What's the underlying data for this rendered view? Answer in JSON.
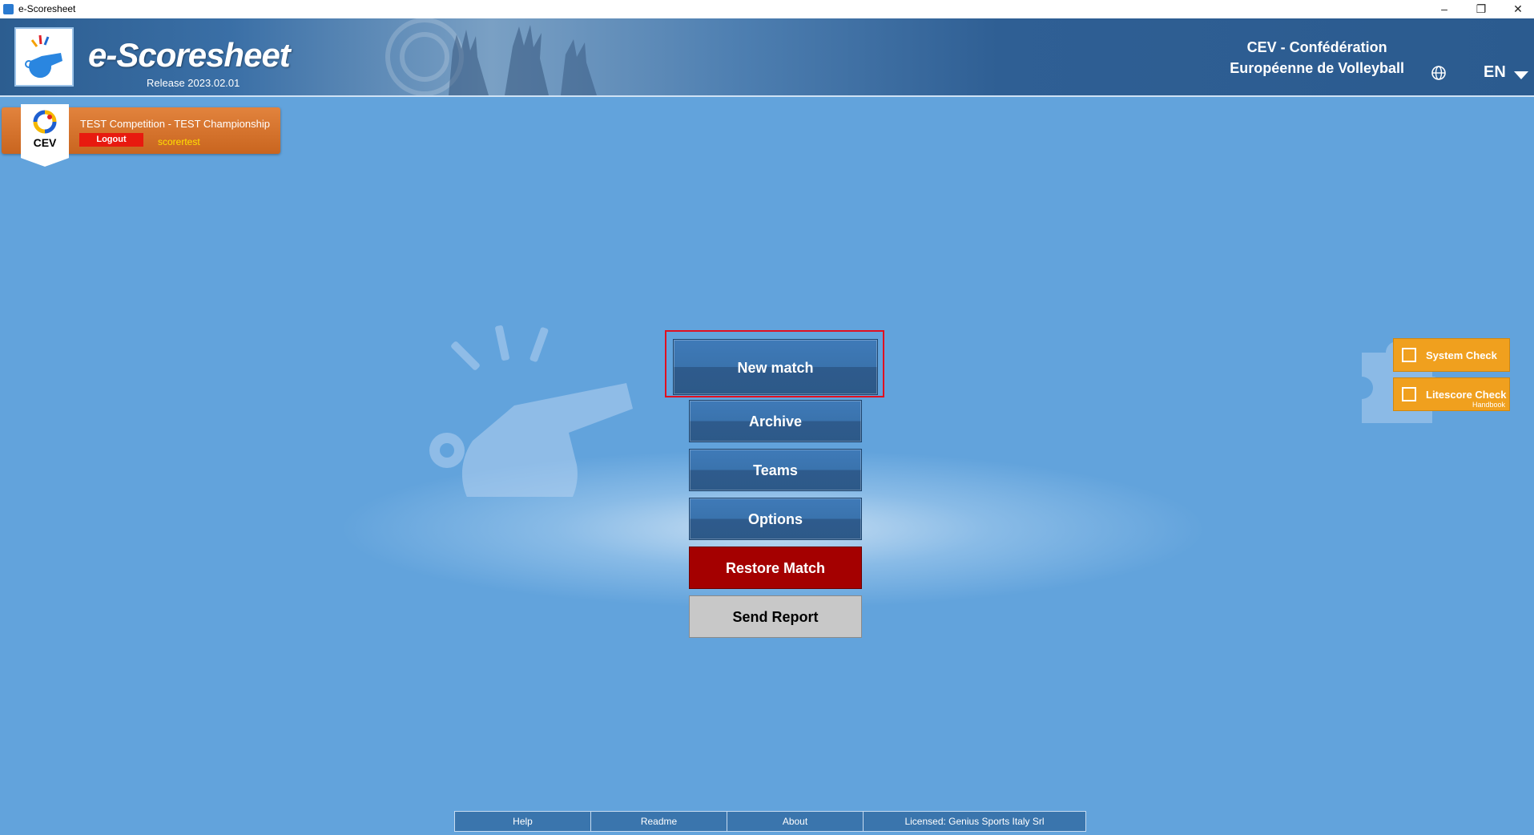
{
  "window": {
    "title": "e-Scoresheet",
    "minimize": "–",
    "restore": "❐",
    "close": "✕"
  },
  "header": {
    "app_name": "e-Scoresheet",
    "release": "Release 2023.02.01",
    "org_line1": "CEV - Confédération",
    "org_line2": "Européenne de Volleyball",
    "language": "EN",
    "globe_icon": "globe-icon",
    "logo_icon": "whistle-logo-icon"
  },
  "competition": {
    "badge_label": "CEV",
    "name": "TEST Competition - TEST Championship",
    "logout_label": "Logout",
    "username": "scorertest"
  },
  "menu": {
    "new_match": "New match",
    "archive": "Archive",
    "teams": "Teams",
    "options": "Options",
    "restore_match": "Restore Match",
    "send_report": "Send Report"
  },
  "side": {
    "system_check": "System Check",
    "litescore_check": "Litescore Check",
    "litescore_sub": "Handbook"
  },
  "footer": {
    "items": [
      "Help",
      "Readme",
      "About",
      "Licensed: Genius Sports Italy Srl"
    ]
  },
  "colors": {
    "background": "#62a3dc",
    "button_blue": "#3a73ad",
    "restore_red": "#a40000",
    "send_gray": "#c8c8c8",
    "check_orange": "#f0a01e",
    "highlight_red": "#e01020"
  }
}
